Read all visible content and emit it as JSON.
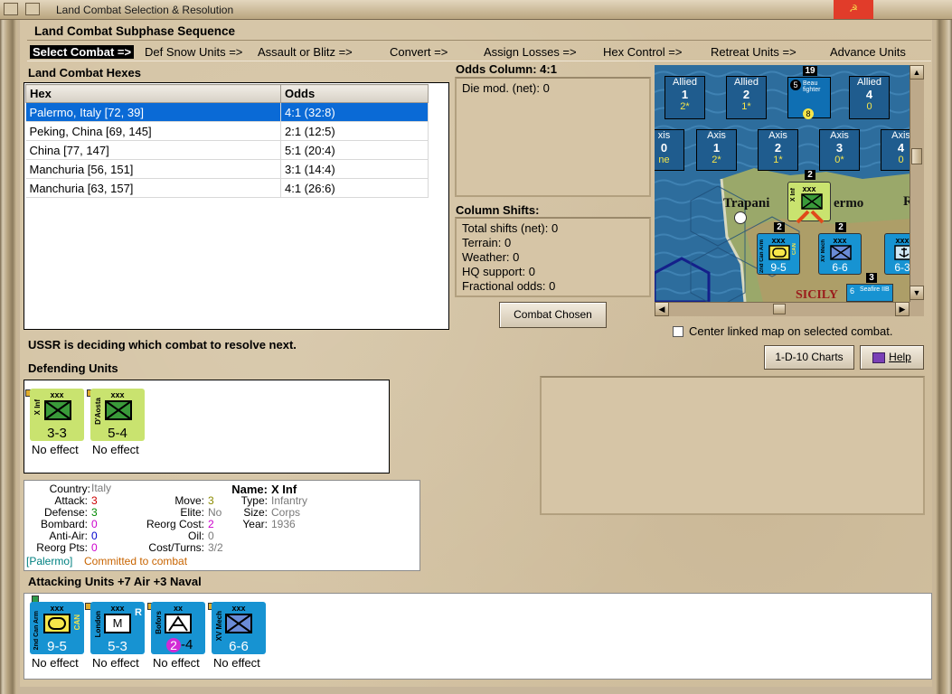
{
  "window": {
    "title": "Land Combat Selection & Resolution",
    "close_glyph": "☭"
  },
  "subphase": {
    "title": "Land Combat Subphase Sequence",
    "steps": [
      "Select Combat =>",
      "Def Snow Units =>",
      "Assault or Blitz =>",
      "Convert =>",
      "Assign Losses =>",
      "Hex Control =>",
      "Retreat Units =>",
      "Advance Units"
    ]
  },
  "hexes": {
    "title": "Land Combat Hexes",
    "columns": [
      "Hex",
      "Odds"
    ],
    "rows": [
      {
        "hex": "Palermo, Italy [72, 39]",
        "odds": "4:1 (32:8)"
      },
      {
        "hex": "Peking, China [69, 145]",
        "odds": "2:1 (12:5)"
      },
      {
        "hex": "China [77, 147]",
        "odds": "5:1 (20:4)"
      },
      {
        "hex": "Manchuria [56, 151]",
        "odds": "3:1 (14:4)"
      },
      {
        "hex": "Manchuria [63, 157]",
        "odds": "4:1 (26:6)"
      }
    ]
  },
  "odds_column": {
    "title": "Odds Column: 4:1",
    "die_mod": "Die mod. (net): 0"
  },
  "column_shifts": {
    "title": "Column Shifts:",
    "items": [
      "Total shifts (net): 0",
      "Terrain: 0",
      "Weather: 0",
      "HQ support: 0",
      "Fractional odds: 0"
    ]
  },
  "combat_chosen_label": "Combat Chosen",
  "map": {
    "allied": [
      {
        "label": "Allied",
        "num": "1",
        "val": "2*"
      },
      {
        "label": "Allied",
        "num": "2",
        "val": "1*"
      },
      {
        "label": "Allied",
        "num": "4",
        "val": "0"
      }
    ],
    "axis": [
      {
        "label": "xis",
        "num": "0",
        "val": "ne"
      },
      {
        "label": "Axis",
        "num": "1",
        "val": "2*"
      },
      {
        "label": "Axis",
        "num": "2",
        "val": "1*"
      },
      {
        "label": "Axis",
        "num": "3",
        "val": "0*"
      },
      {
        "label": "Axis",
        "num": "4",
        "val": "0"
      }
    ],
    "stack_count": "19",
    "stack_top_a": "5",
    "stack_top_b": "8",
    "stack_name": "Beau fighter",
    "places": {
      "trapani": "Trapani",
      "ermo": "ermo",
      "sicily": "SICILY",
      "r": "R"
    },
    "badges": [
      "2",
      "2",
      "2",
      "3"
    ],
    "hex_counters": [
      {
        "name": "X Inf",
        "xxx": "xxx"
      },
      {
        "name": "2nd Can Arm",
        "xxx": "xxx",
        "str": "9-5",
        "tag": "CAN"
      },
      {
        "name": "XV Mech",
        "xxx": "xxx",
        "str": "6-6"
      },
      {
        "name": "",
        "xxx": "xxx",
        "str": "6-3"
      }
    ],
    "air_label": "6",
    "air_name": "Seafire IIB"
  },
  "center_map_label": "Center linked map on selected combat.",
  "status": "USSR is deciding which combat to resolve next.",
  "charts_button": "1-D-10 Charts",
  "help_button": "Help",
  "defending": {
    "title": "Defending Units",
    "units": [
      {
        "name": "X Inf",
        "xxx": "xxx",
        "str": "3-3",
        "effect": "No effect"
      },
      {
        "name": "D'Aosta",
        "xxx": "xxx",
        "str": "5-4",
        "effect": "No effect"
      }
    ]
  },
  "details": {
    "country_l": "Country:",
    "country": "Italy",
    "attack_l": "Attack:",
    "attack": "3",
    "defense_l": "Defense:",
    "defense": "3",
    "bombard_l": "Bombard:",
    "bombard": "0",
    "antiair_l": "Anti-Air:",
    "antiair": "0",
    "reorgpts_l": "Reorg Pts:",
    "reorgpts": "0",
    "move_l": "Move:",
    "move": "3",
    "elite_l": "Elite:",
    "elite": "No",
    "reorgcost_l": "Reorg Cost:",
    "reorgcost": "2",
    "oil_l": "Oil:",
    "oil": "0",
    "costturns_l": "Cost/Turns:",
    "costturns": "3/2",
    "name_l": "Name:",
    "name": "X Inf",
    "type_l": "Type:",
    "type": "Infantry",
    "size_l": "Size:",
    "size": "Corps",
    "year_l": "Year:",
    "year": "1936",
    "location": "[Palermo]",
    "status": "Committed to combat"
  },
  "attacking": {
    "title": "Attacking Units +7 Air +3 Naval",
    "units": [
      {
        "name": "2nd Can Arm",
        "xxx": "xxx",
        "tag": "CAN",
        "str": "9-5",
        "effect": "No effect"
      },
      {
        "name": "London",
        "xxx": "xxx",
        "tag": "R",
        "sym": "M",
        "str": "5-3",
        "effect": "No effect"
      },
      {
        "name": "Bofors",
        "xxx": "xx",
        "str_a": "2",
        "str_b": "-4",
        "effect": "No effect"
      },
      {
        "name": "XV Mech",
        "xxx": "xxx",
        "str": "6-6",
        "effect": "No effect"
      }
    ]
  },
  "colors": {
    "selection": "#0a6ad6",
    "italy_counter": "#c9e36f",
    "allied_counter": "#1793d2",
    "detail_red": "#cc0000",
    "detail_green": "#008800",
    "detail_magenta": "#cc00cc",
    "detail_blue": "#0000cc",
    "detail_gray": "#7a7a7a",
    "detail_teal": "#008080",
    "detail_orange": "#c86400"
  }
}
